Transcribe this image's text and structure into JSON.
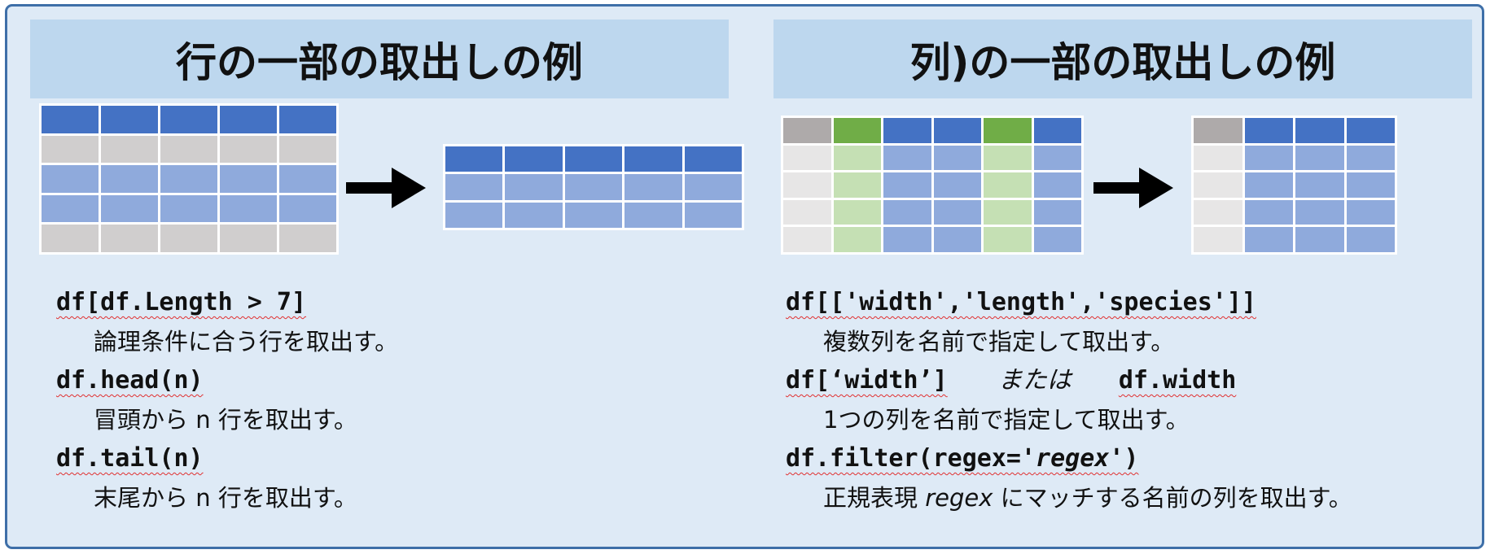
{
  "titles": {
    "left": "行の一部の取出しの例",
    "right": "列)の一部の取出しの例"
  },
  "colors": {
    "header_blue": "#4472c4",
    "row_blue": "#8faadc",
    "row_gray": "#d0cece",
    "gray_header": "#aeaaaa",
    "gray_light": "#e7e6e6",
    "green_header": "#70ad47",
    "green_light": "#c5e0b4"
  },
  "left_code": {
    "line1_code": "df[df.Length > 7]",
    "line1_desc": "論理条件に合う行を取出す。",
    "line2_code": "df.head(n)",
    "line2_desc": "冒頭から n 行を取出す。",
    "line3_code": "df.tail(n)",
    "line3_desc": "末尾から n 行を取出す。"
  },
  "right_code": {
    "line1_code": "df[['width','length','species']]",
    "line1_desc": "複数列を名前で指定して取出す。",
    "line2_code_a": "df[‘width’]",
    "line2_or": "または",
    "line2_code_b": "df.width",
    "line2_desc": "1つの列を名前で指定して取出す。",
    "line3_code_a": "df.filter(regex='",
    "line3_code_b": "regex",
    "line3_code_c": "')",
    "line3_desc_a": "正規表現",
    "line3_desc_b": "regex",
    "line3_desc_c": "にマッチする名前の列を取出す。"
  }
}
